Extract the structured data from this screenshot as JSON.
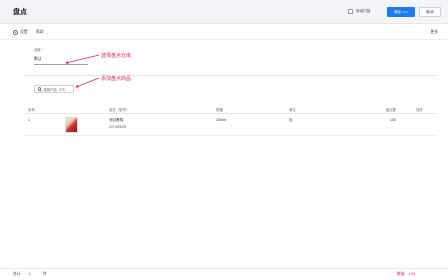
{
  "header": {
    "title": "盘点",
    "checkbox_label": "继续扫描",
    "confirm_label": "确定",
    "confirm_shortcut": "(F2)",
    "cancel_label": "取消"
  },
  "toolbar": {
    "settings_label": "设置",
    "help_label": "帮助",
    "more_label": "更多"
  },
  "warehouse": {
    "label": "仓库",
    "required_mark": "*",
    "value": "默认"
  },
  "search": {
    "placeholder": "选择产品（F3）"
  },
  "annotations": {
    "select_warehouse": "选择盘点仓库",
    "add_product": "添加盘点商品"
  },
  "table": {
    "headers": {
      "index": "序号",
      "name": "品名（型号）",
      "spec": "规格",
      "unit": "单位",
      "qty": "盘点数",
      "op": "操作"
    },
    "rows": [
      {
        "index": "1",
        "name": "测试蛋糕",
        "code": "CH 000025",
        "spec": "200ml",
        "unit": "包",
        "qty": "100"
      }
    ]
  },
  "footer": {
    "total_label": "合计",
    "total_value": "1",
    "count": "件",
    "qty_label": "数量:",
    "qty_value": "100"
  },
  "colors": {
    "accent": "#1d7bf0",
    "annotation": "#e0245e"
  }
}
